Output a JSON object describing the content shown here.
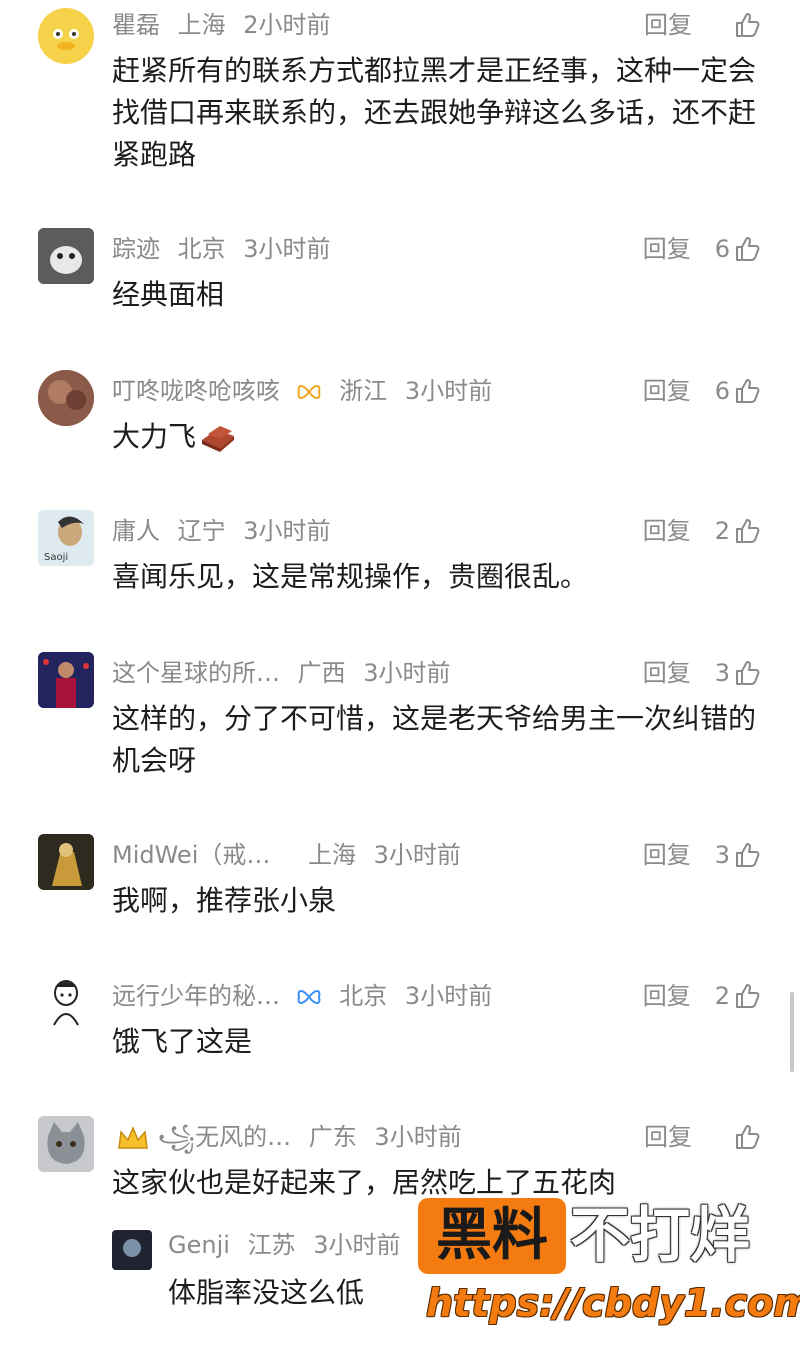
{
  "comments": [
    {
      "user": "瞿磊",
      "location": "上海",
      "time": "2小时前",
      "reply": "回复",
      "likes": "",
      "text": "赶紧所有的联系方式都拉黑才是正经事，这种一定会找借口再来联系的，还去跟她争辩这么多话，还不赶紧跑路"
    },
    {
      "user": "踪迹",
      "location": "北京",
      "time": "3小时前",
      "reply": "回复",
      "likes": "6",
      "text": "经典面相"
    },
    {
      "user": "叮咚咙咚呛咳咳",
      "location": "浙江",
      "time": "3小时前",
      "reply": "回复",
      "likes": "6",
      "text": "大力飞"
    },
    {
      "user": "庸人",
      "location": "辽宁",
      "time": "3小时前",
      "reply": "回复",
      "likes": "2",
      "text": "喜闻乐见，这是常规操作，贵圈很乱。"
    },
    {
      "user": "这个星球的所…",
      "location": "广西",
      "time": "3小时前",
      "reply": "回复",
      "likes": "3",
      "text": "这样的，分了不可惜，这是老天爷给男主一次纠错的机会呀"
    },
    {
      "user": "MidWei（戒…",
      "location": "上海",
      "time": "3小时前",
      "reply": "回复",
      "likes": "3",
      "text": "我啊，推荐张小泉"
    },
    {
      "user": "远行少年的秘…",
      "location": "北京",
      "time": "3小时前",
      "reply": "回复",
      "likes": "2",
      "text": "饿飞了这是"
    },
    {
      "user": "꧁无风的…",
      "location": "广东",
      "time": "3小时前",
      "reply": "回复",
      "likes": "",
      "text": "这家伙也是好起来了，居然吃上了五花肉"
    }
  ],
  "subreply": {
    "user": "Genji",
    "location": "江苏",
    "time": "3小时前",
    "text": "体脂率没这么低"
  },
  "watermark": {
    "left": "黑料",
    "right": "不打烊",
    "url": "https://cbdy1.com"
  },
  "colors": {
    "meta": "#8a8a8a",
    "text": "#1d1d1d",
    "badge": "#f5a623",
    "badge_blue": "#3a8ef6",
    "watermark": "#f47b10"
  }
}
